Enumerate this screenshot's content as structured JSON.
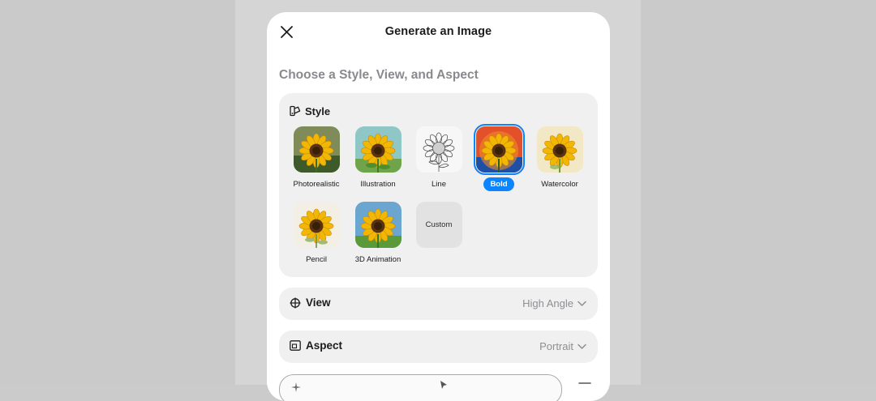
{
  "header": {
    "title": "Generate an Image",
    "close_icon": "close-icon"
  },
  "section_title": "Choose a Style, View, and Aspect",
  "style": {
    "label": "Style",
    "icon": "style-brush-icon",
    "options": [
      {
        "label": "Photorealistic",
        "selected": false
      },
      {
        "label": "Illustration",
        "selected": false
      },
      {
        "label": "Line",
        "selected": false
      },
      {
        "label": "Bold",
        "selected": true
      },
      {
        "label": "Watercolor",
        "selected": false
      },
      {
        "label": "Pencil",
        "selected": false
      },
      {
        "label": "3D Animation",
        "selected": false
      },
      {
        "label": "Custom",
        "selected": false
      }
    ]
  },
  "view": {
    "label": "View",
    "value": "High Angle",
    "icon": "crosshair-icon"
  },
  "aspect": {
    "label": "Aspect",
    "value": "Portrait",
    "icon": "aspect-frame-icon"
  },
  "colors": {
    "accent": "#0a84ff",
    "card": "#f0f0f0",
    "sheet": "#ffffff"
  }
}
